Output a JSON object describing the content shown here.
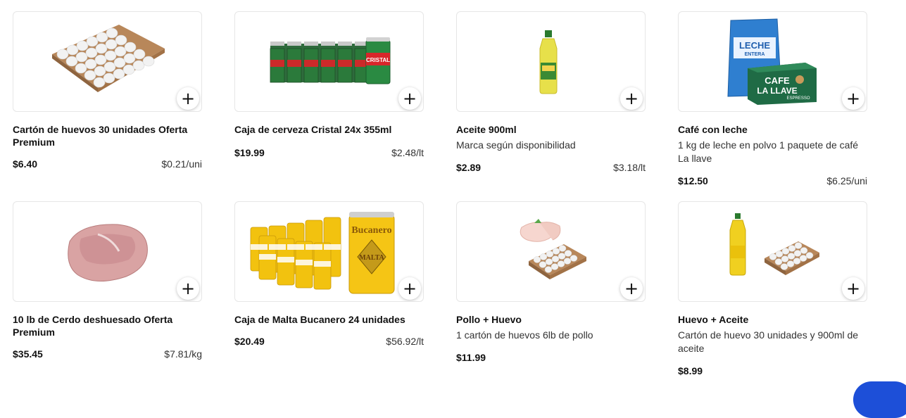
{
  "products": [
    {
      "name": "Cartón de huevos 30 unidades Oferta Premium",
      "description": "",
      "price": "$6.40",
      "unit_price": "$0.21/uni",
      "image": "egg-carton-image"
    },
    {
      "name": "Caja de cerveza Cristal 24x 355ml",
      "description": "",
      "price": "$19.99",
      "unit_price": "$2.48/lt",
      "image": "beer-cans-image"
    },
    {
      "name": "Aceite 900ml",
      "description": "Marca según disponibilidad",
      "price": "$2.89",
      "unit_price": "$3.18/lt",
      "image": "oil-bottle-image"
    },
    {
      "name": "Café con leche",
      "description": "1 kg de leche en polvo 1 paquete de café La llave",
      "price": "$12.50",
      "unit_price": "$6.25/uni",
      "image": "milk-coffee-image"
    },
    {
      "name": "10 lb de Cerdo deshuesado Oferta Premium",
      "description": "",
      "price": "$35.45",
      "unit_price": "$7.81/kg",
      "image": "pork-image"
    },
    {
      "name": "Caja de Malta Bucanero 24 unidades",
      "description": "",
      "price": "$20.49",
      "unit_price": "$56.92/lt",
      "image": "malta-cans-image"
    },
    {
      "name": "Pollo + Huevo",
      "description": "1 cartón de huevos 6lb de pollo",
      "price": "$11.99",
      "unit_price": "",
      "image": "chicken-eggs-image"
    },
    {
      "name": "Huevo + Aceite",
      "description": "Cartón de huevo 30 unidades y 900ml de aceite",
      "price": "$8.99",
      "unit_price": "",
      "image": "eggs-oil-image"
    }
  ],
  "image_labels": {
    "beer_brand": "CRISTAL",
    "milk_label": "LECHE",
    "milk_sub": "ENTERA",
    "coffee_label_1": "CAFE",
    "coffee_label_2": "LA LLAVE",
    "coffee_sub": "ESPRESSO",
    "malta_brand": "Bucanero",
    "malta_label": "MALTA"
  },
  "add_button_label": "+",
  "colors": {
    "accent": "#1d4fd8",
    "border": "#e6e6e6"
  }
}
